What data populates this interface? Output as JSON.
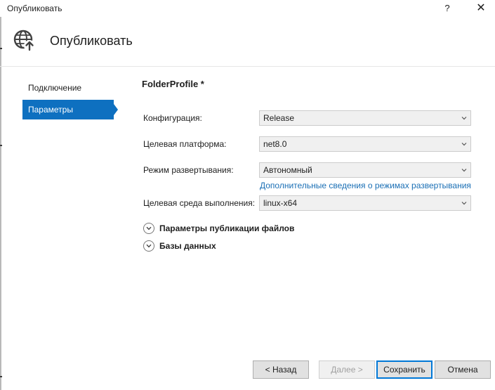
{
  "window": {
    "title": "Опубликовать",
    "help_label": "?",
    "close_label": "✕"
  },
  "header": {
    "title": "Опубликовать",
    "icon": "globe-publish-icon"
  },
  "nav": {
    "items": [
      {
        "label": "Подключение",
        "selected": false
      },
      {
        "label": "Параметры",
        "selected": true
      }
    ]
  },
  "profile": {
    "name": "FolderProfile *"
  },
  "fields": {
    "configuration": {
      "label": "Конфигурация:",
      "value": "Release"
    },
    "target_framework": {
      "label": "Целевая платформа:",
      "value": "net8.0"
    },
    "deployment_mode": {
      "label": "Режим развертывания:",
      "value": "Автономный"
    },
    "deployment_link": "Дополнительные сведения о режимах развертывания",
    "target_runtime": {
      "label": "Целевая среда выполнения:",
      "value": "linux-x64"
    }
  },
  "sections": {
    "file_publish_options": "Параметры публикации файлов",
    "databases": "Базы данных"
  },
  "buttons": {
    "back": "< Назад",
    "next": "Далее >",
    "save": "Сохранить",
    "cancel": "Отмена"
  },
  "colors": {
    "accent": "#0e70c0",
    "link": "#1a6fb5"
  }
}
